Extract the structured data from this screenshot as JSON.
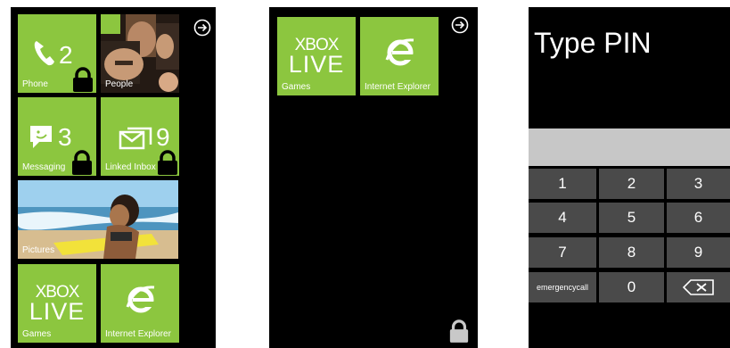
{
  "start_screen": {
    "tiles": {
      "phone": {
        "label": "Phone",
        "count": "2"
      },
      "people": {
        "label": "People"
      },
      "messaging": {
        "label": "Messaging",
        "count": "3"
      },
      "inbox": {
        "label": "Linked Inbox",
        "count": "9"
      },
      "pictures": {
        "label": "Pictures"
      },
      "xbox": {
        "logo_top": "XBOX",
        "logo_bottom": "LIVE",
        "label": "Games"
      },
      "ie": {
        "label": "Internet Explorer"
      }
    }
  },
  "apps_screen": {
    "tiles": {
      "xbox": {
        "logo_top": "XBOX",
        "logo_bottom": "LIVE",
        "label": "Games"
      },
      "ie": {
        "label": "Internet Explorer"
      }
    }
  },
  "pin_screen": {
    "title": "Type PIN",
    "keys": [
      "1",
      "2",
      "3",
      "4",
      "5",
      "6",
      "7",
      "8",
      "9",
      "emergencycall",
      "0"
    ]
  },
  "colors": {
    "tile": "#8cc63f",
    "background": "#000000",
    "key": "#4a4a4a",
    "pin_field": "#c7c7c7"
  },
  "icons": [
    "phone-icon",
    "smiley-message-icon",
    "envelope-icon",
    "padlock-icon",
    "arrow-circle-icon",
    "ie-logo-icon",
    "backspace-icon"
  ]
}
